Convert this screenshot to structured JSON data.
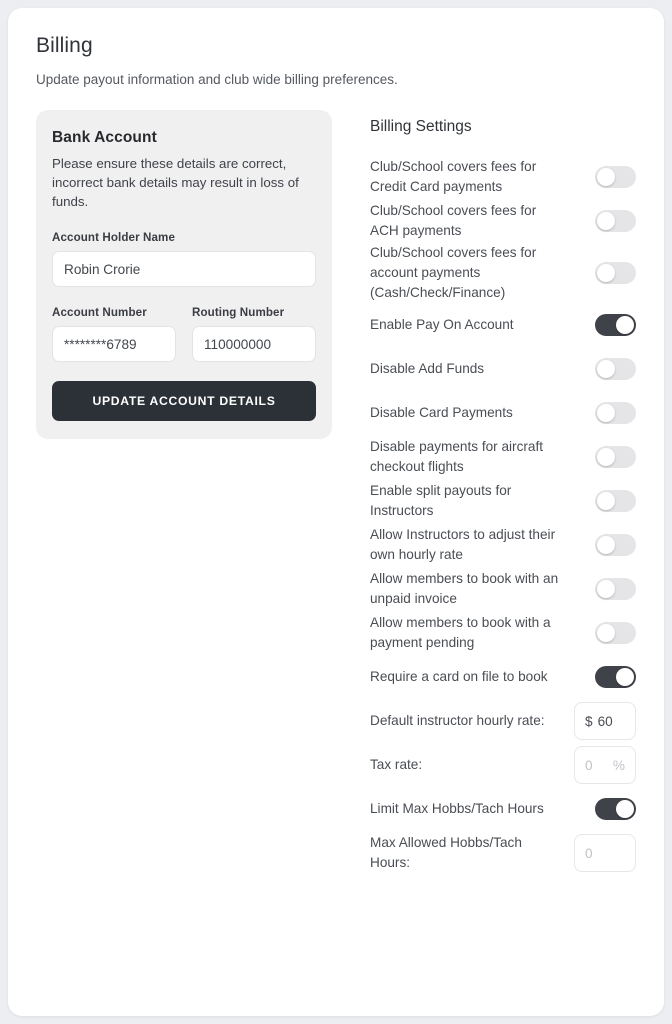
{
  "page": {
    "title": "Billing",
    "subtitle": "Update payout information and club wide billing preferences."
  },
  "bank_account": {
    "title": "Bank Account",
    "description": "Please ensure these details are correct, incorrect bank details may result in loss of funds.",
    "account_holder_label": "Account Holder Name",
    "account_holder_value": "Robin Crorie",
    "account_number_label": "Account Number",
    "account_number_value": "********6789",
    "routing_number_label": "Routing Number",
    "routing_number_value": "110000000",
    "update_button": "UPDATE ACCOUNT DETAILS"
  },
  "billing_settings": {
    "title": "Billing Settings",
    "toggles": [
      {
        "label": "Club/School covers fees for Credit Card payments",
        "on": false
      },
      {
        "label": "Club/School covers fees for ACH payments",
        "on": false
      },
      {
        "label": "Club/School covers fees for account payments (Cash/Check/Finance)",
        "on": false
      },
      {
        "label": "Enable Pay On Account",
        "on": true
      },
      {
        "label": "Disable Add Funds",
        "on": false
      },
      {
        "label": "Disable Card Payments",
        "on": false
      },
      {
        "label": "Disable payments for aircraft checkout flights",
        "on": false
      },
      {
        "label": "Enable split payouts for Instructors",
        "on": false
      },
      {
        "label": "Allow Instructors to adjust their own hourly rate",
        "on": false
      },
      {
        "label": "Allow members to book with an unpaid invoice",
        "on": false
      },
      {
        "label": "Allow members to book with a payment pending",
        "on": false
      },
      {
        "label": "Require a card on file to book",
        "on": true
      }
    ],
    "instructor_rate": {
      "label": "Default instructor hourly rate:",
      "prefix": "$",
      "value": "60"
    },
    "tax_rate": {
      "label": "Tax rate:",
      "placeholder": "0",
      "suffix": "%"
    },
    "limit_hobbs": {
      "label": "Limit Max Hobbs/Tach Hours",
      "on": true
    },
    "max_hobbs": {
      "label": "Max Allowed Hobbs/Tach Hours:",
      "placeholder": "0"
    }
  },
  "colors": {
    "page_bg": "#eceef1",
    "card_bg": "#ffffff",
    "bank_card_bg": "#f0f0f1",
    "button_dark": "#2c3037",
    "toggle_on": "#3f4248",
    "toggle_off": "#e5e5e7"
  }
}
